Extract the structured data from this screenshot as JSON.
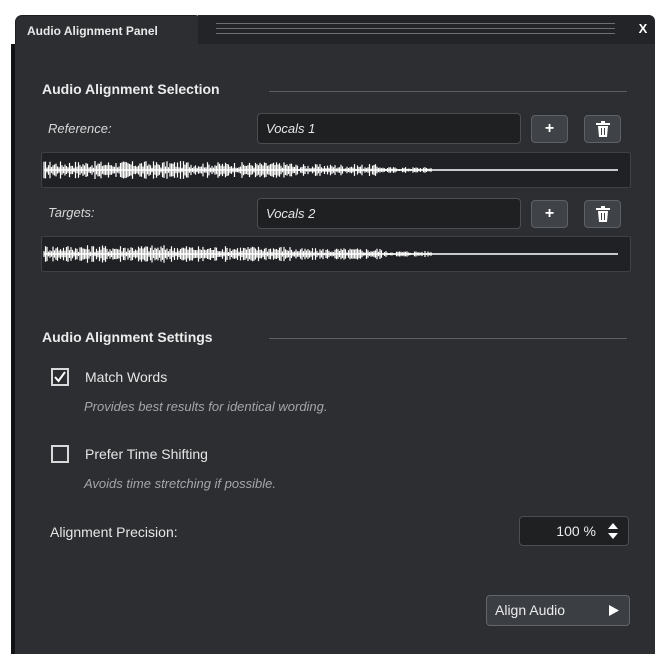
{
  "window": {
    "tab_title": "Audio Alignment Panel",
    "close_label": "X"
  },
  "selection": {
    "title": "Audio Alignment Selection",
    "reference_label": "Reference:",
    "reference_value": "Vocals 1",
    "targets_label": "Targets:",
    "targets_value": "Vocals 2",
    "add_label": "+",
    "icons": [
      "plus-icon",
      "trash-icon",
      "waveform-icon"
    ]
  },
  "settings": {
    "title": "Audio Alignment Settings",
    "match_words": {
      "label": "Match Words",
      "checked": true,
      "hint": "Provides best results for identical wording."
    },
    "prefer_time_shifting": {
      "label": "Prefer Time Shifting",
      "checked": false,
      "hint": "Avoids time stretching if possible."
    },
    "precision_label": "Alignment Precision:",
    "precision_value": "100 %"
  },
  "actions": {
    "align_label": "Align Audio"
  },
  "colors": {
    "panel_bg": "#2c2e31",
    "field_bg": "#1f2022",
    "text": "#e6e6e6",
    "hint_text": "#a4a6aa"
  }
}
